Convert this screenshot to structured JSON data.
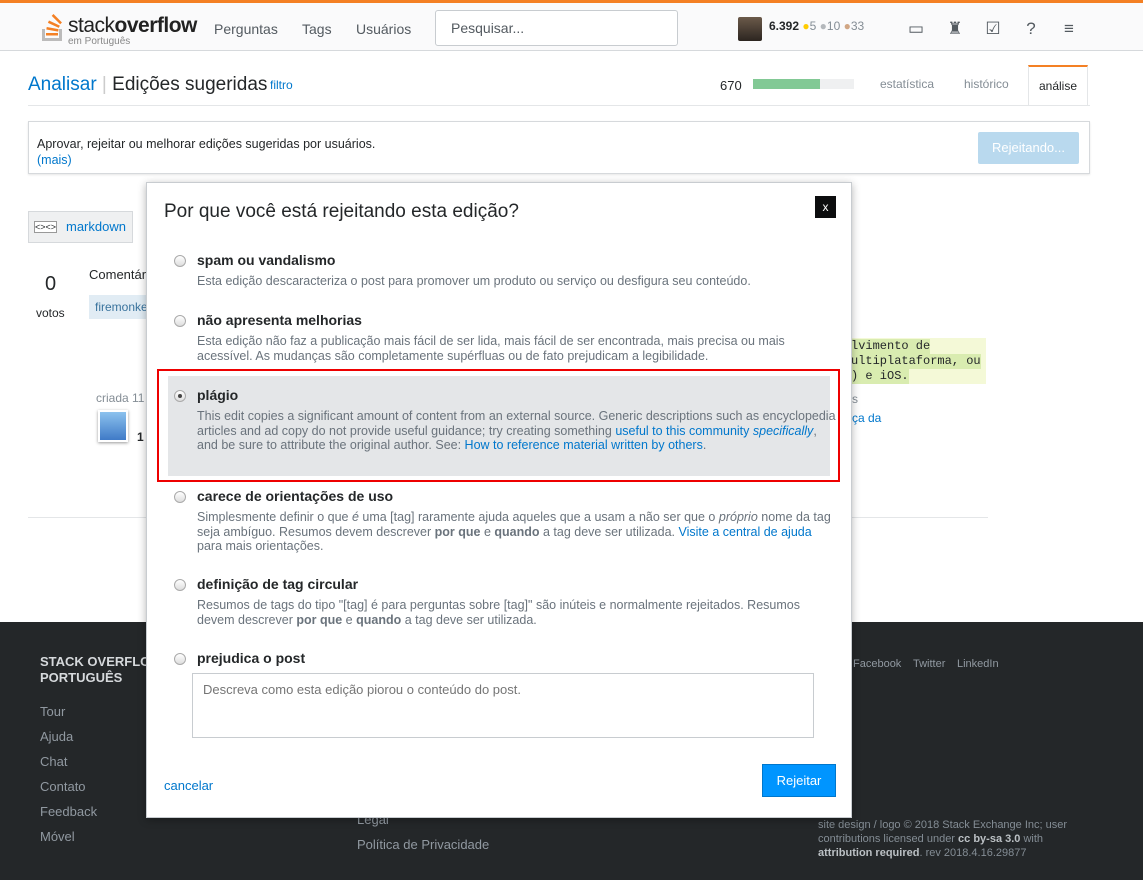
{
  "header": {
    "logo_word_a": "stack",
    "logo_word_b": "overflow",
    "logo_sub": "em Português",
    "nav": [
      "Perguntas",
      "Tags",
      "Usuários"
    ],
    "search_placeholder": "Pesquisar...",
    "reputation": "6.392",
    "gold": "5",
    "silver": "10",
    "bronze": "33",
    "colors": {
      "accent": "#f48024",
      "gold": "#ffcc01",
      "silver": "#b4b8bc",
      "bronze": "#d1a684"
    }
  },
  "subhead": {
    "crumb": "Analisar",
    "title": "Edições sugeridas",
    "filter": "filtro",
    "count": "670",
    "progress_percent": 66,
    "tabs": [
      "estatística",
      "histórico",
      "análise"
    ]
  },
  "infobox": {
    "text": "Aprovar, rejeitar ou melhorar edições sugeridas por usuários.",
    "more": "(mais)",
    "button": "Rejeitando..."
  },
  "background": {
    "markdown": "markdown",
    "votes": "0",
    "votes_label": "votos",
    "comment": "Comentár",
    "tag": "firemonke",
    "created": "criada 11",
    "code_lines": [
      "lvimento de",
      "ultiplataforma, ou",
      ") e iOS."
    ],
    "side1": "s",
    "side2": "ça da",
    "num": "1"
  },
  "modal": {
    "title": "Por que você está rejeitando esta edição?",
    "close": "x",
    "options": [
      {
        "label": "spam ou vandalismo",
        "desc": "Esta edição descaracteriza o post para promover um produto ou serviço ou desfigura seu conteúdo."
      },
      {
        "label": "não apresenta melhorias",
        "desc": "Esta edição não faz a publicação mais fácil de ser lida, mais fácil de ser encontrada, mais precisa ou mais acessível. As mudanças são completamente supérfluas ou de fato prejudicam a legibilidade."
      },
      {
        "label": "plágio",
        "desc_a": "This edit copies a significant amount of content from an external source. Generic descriptions such as encyclopedia articles and ad copy do not provide useful guidance; try creating something ",
        "link1": "useful to this community ",
        "link1_em": "specifically",
        "desc_b": ", and be sure to attribute the original author. See: ",
        "link2": "How to reference material written by others",
        "desc_c": "."
      },
      {
        "label": "carece de orientações de uso",
        "d1": "Simplesmente definir o que ",
        "d1em": "é",
        "d2": " uma [tag] raramente ajuda aqueles que a usam a não ser que o ",
        "d2em": "próprio",
        "d3": " nome da tag seja ambíguo. Resumos devem descrever ",
        "b1": "por que",
        "d4": " e ",
        "b2": "quando",
        "d5": " a tag deve ser utilizada. ",
        "link": "Visite a central de ajuda",
        "d6": " para mais orientações."
      },
      {
        "label": "definição de tag circular",
        "d1": "Resumos de tags do tipo \"[tag] é para perguntas sobre [tag]\" são inúteis e normalmente rejeitados. Resumos devem descrever ",
        "b1": "por que",
        "d2": " e ",
        "b2": "quando",
        "d3": " a tag deve ser utilizada."
      },
      {
        "label": "prejudica o post",
        "placeholder": "Descreva como esta edição piorou o conteúdo do post."
      }
    ],
    "selected": "plágio",
    "cancel": "cancelar",
    "submit": "Rejeitar"
  },
  "footer": {
    "brand1": "STACK OVERFLO",
    "brand2": "PORTUGUÊS",
    "links": [
      "Tour",
      "Ajuda",
      "Chat",
      "Contato",
      "Feedback",
      "Móvel"
    ],
    "mid": [
      "Legal",
      "Política de Privacidade"
    ],
    "social": [
      "Facebook",
      "Twitter",
      "LinkedIn"
    ],
    "copy_a": "site design / logo © 2018 Stack Exchange Inc; user contributions licensed under ",
    "cc": "cc by-sa 3.0",
    "copy_b": " with ",
    "attr": "attribution required",
    "copy_c": ". rev 2018.4.16.29877"
  }
}
